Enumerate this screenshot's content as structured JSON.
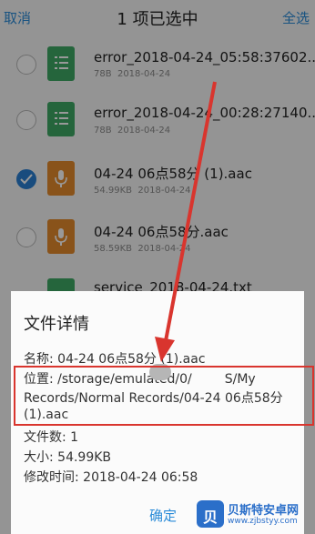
{
  "header": {
    "cancel_label": "取消",
    "title": "1 项已选中",
    "select_all_label": "全选"
  },
  "files": [
    {
      "name": "error_2018-04-24_05:58:37602...",
      "size": "78B",
      "date": "2018-04-24",
      "type": "text",
      "selected": false
    },
    {
      "name": "error_2018-04-24_00:28:27140...",
      "size": "78B",
      "date": "2018-04-24",
      "type": "text",
      "selected": false
    },
    {
      "name": "04-24 06点58分 (1).aac",
      "size": "54.99KB",
      "date": "2018-04-24",
      "type": "audio",
      "selected": true
    },
    {
      "name": "04-24 06点58分.aac",
      "size": "58.59KB",
      "date": "2018-04-24",
      "type": "audio",
      "selected": false
    },
    {
      "name": "service_2018-04-24.txt",
      "size": "",
      "date": "",
      "type": "text",
      "selected": false
    }
  ],
  "dialog": {
    "title": "文件详情",
    "name_line": "名称: 04-24 06点58分 (1).aac",
    "location_line_1": "位置: /storage/emulated/0/",
    "location_line_1_end": "S/My",
    "location_line_2": "Records/Normal Records/04-24 06点58分",
    "location_line_3": "(1).aac",
    "count_line": "文件数: 1",
    "size_line": "大小: 54.99KB",
    "modified_line": "修改时间: 2018-04-24 06:58",
    "ok_label": "确定"
  },
  "watermark": {
    "logo_text": "贝",
    "title": "贝斯特安卓网",
    "url": "www.zjbstyy.com"
  },
  "colors": {
    "accent": "#2a8bd8",
    "text_file_icon": "#3fa865",
    "audio_file_icon": "#e58a2c",
    "annotation": "#d9352e"
  }
}
